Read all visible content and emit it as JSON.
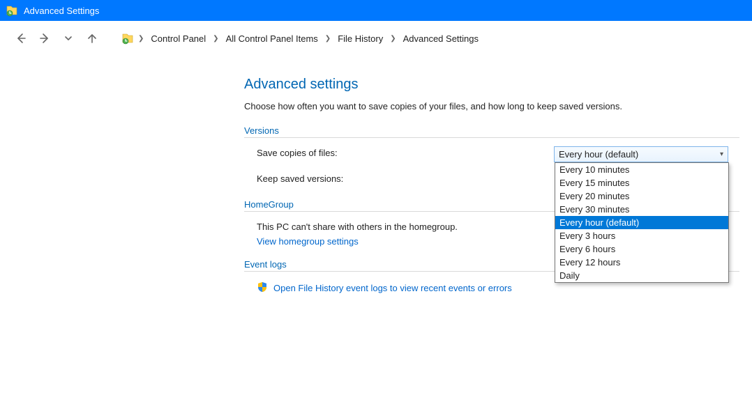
{
  "titlebar": {
    "title": "Advanced Settings"
  },
  "breadcrumb": {
    "items": [
      "Control Panel",
      "All Control Panel Items",
      "File History",
      "Advanced Settings"
    ]
  },
  "page_title": "Advanced settings",
  "page_desc": "Choose how often you want to save copies of your files, and how long to keep saved versions.",
  "sections": {
    "versions": {
      "label": "Versions",
      "save_copies_label": "Save copies of files:",
      "save_copies_selected": "Every hour (default)",
      "save_copies_options": [
        "Every 10 minutes",
        "Every 15 minutes",
        "Every 20 minutes",
        "Every 30 minutes",
        "Every hour (default)",
        "Every 3 hours",
        "Every 6 hours",
        "Every 12 hours",
        "Daily"
      ],
      "keep_saved_label": "Keep saved versions:"
    },
    "homegroup": {
      "label": "HomeGroup",
      "body": "This PC can't share with others in the homegroup.",
      "link": "View homegroup settings"
    },
    "eventlogs": {
      "label": "Event logs",
      "link": "Open File History event logs to view recent events or errors"
    }
  }
}
